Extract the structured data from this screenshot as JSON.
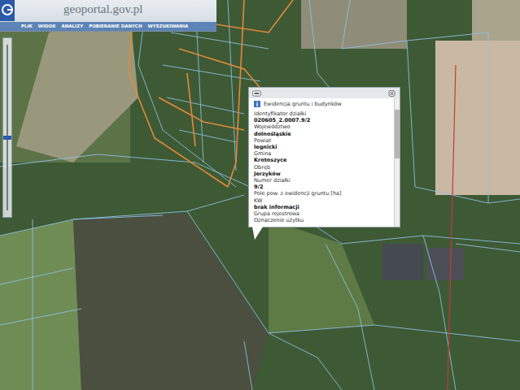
{
  "header": {
    "logo": "geoportal.gov.pl",
    "menu": [
      "PLIK",
      "WIDOK",
      "ANALIZY",
      "POBIERANIE DANYCH",
      "WYSZUKIWANIA"
    ]
  },
  "zoom": {
    "level": 0.55
  },
  "popup": {
    "title": "Ewidencja gruntu i budynków",
    "fields": [
      {
        "text": "Identyfikator działki",
        "kind": "label"
      },
      {
        "text": "020605_2.0007.9/2",
        "kind": "value"
      },
      {
        "text": "Województwo",
        "kind": "label"
      },
      {
        "text": "dolnośląskie",
        "kind": "value"
      },
      {
        "text": "Powiat",
        "kind": "label"
      },
      {
        "text": "legnicki",
        "kind": "value"
      },
      {
        "text": "Gmina",
        "kind": "label"
      },
      {
        "text": "Krotoszyce",
        "kind": "value"
      },
      {
        "text": "Obręb",
        "kind": "label"
      },
      {
        "text": "Jerzyków",
        "kind": "value"
      },
      {
        "text": "Numer działki",
        "kind": "label"
      },
      {
        "text": "9/2",
        "kind": "value"
      },
      {
        "text": "Pole pow. z ewidencji gruntu [ha]",
        "kind": "label"
      },
      {
        "text": "KW",
        "kind": "label"
      },
      {
        "text": "brak informacji",
        "kind": "value"
      },
      {
        "text": "Grupa rejestrowa",
        "kind": "label"
      },
      {
        "text": "Oznaczenie użytku",
        "kind": "label"
      }
    ]
  }
}
